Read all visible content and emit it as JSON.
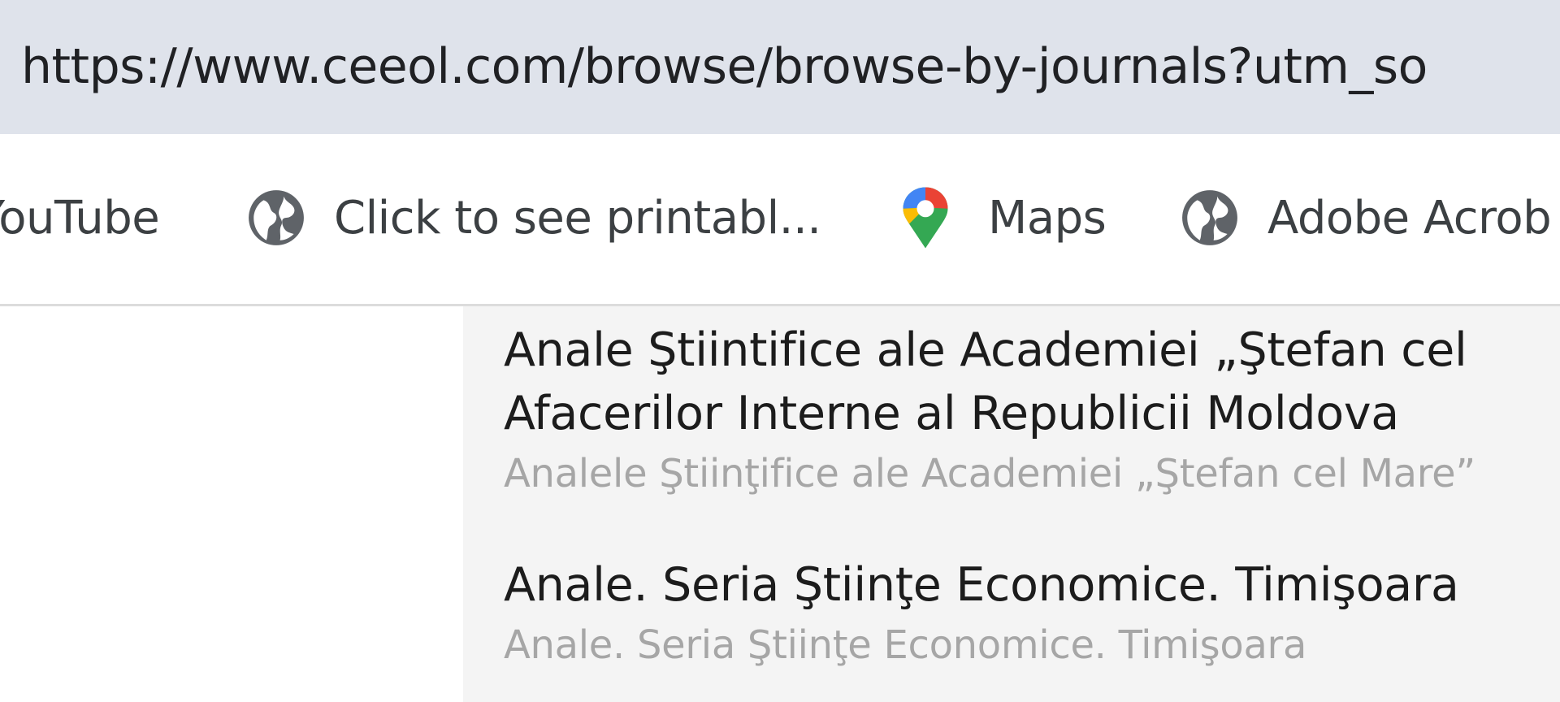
{
  "address_bar": {
    "url": "https://www.ceeol.com/browse/browse-by-journals?utm_so"
  },
  "bookmarks": [
    {
      "label": "YouTube",
      "icon": "youtube-icon"
    },
    {
      "label": "Click to see printabl...",
      "icon": "globe-icon"
    },
    {
      "label": "Maps",
      "icon": "google-maps-icon"
    },
    {
      "label": "Adobe Acrob",
      "icon": "globe-icon"
    }
  ],
  "results": [
    {
      "title_line1": "Anale Ştiintifice ale Academiei „Ştefan cel",
      "title_line2": "Afacerilor Interne al Republicii Moldova",
      "subtitle": "Analele Ştiinţifice ale Academiei „Ştefan cel Mare”"
    },
    {
      "title": "Anale. Seria Ştiinţe Economice. Timişoara",
      "subtitle": "Anale. Seria Ştiinţe Economice. Timişoara"
    }
  ],
  "colors": {
    "address_bar_bg": "#dfe3eb",
    "results_bg": "#f4f4f4",
    "subtitle_text": "#a6a6a6"
  }
}
